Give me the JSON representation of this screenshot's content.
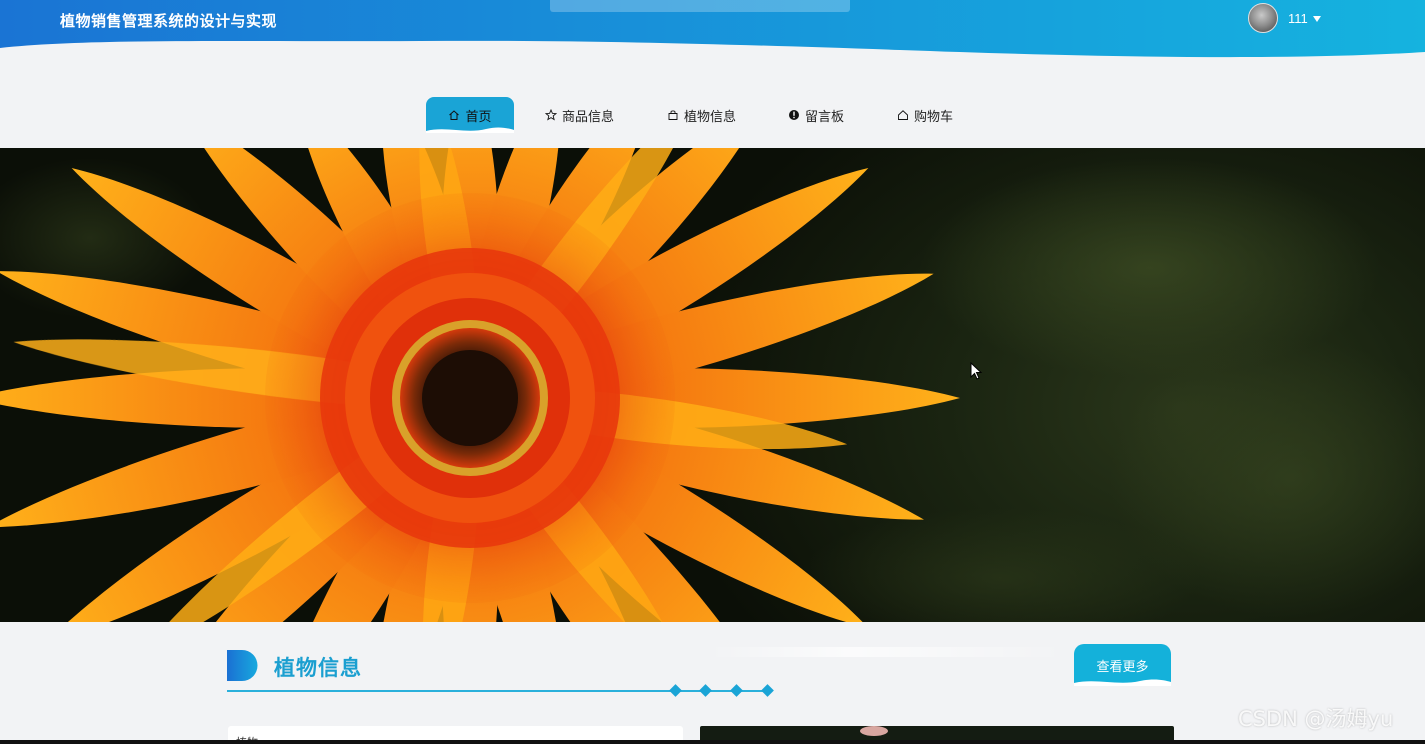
{
  "header": {
    "site_title": "植物销售管理系统的设计与实现",
    "user_name": "111",
    "gradient_start": "#1a78d6",
    "gradient_end": "#17b4e0"
  },
  "nav": {
    "items": [
      {
        "label": "首页",
        "icon": "home-icon",
        "active": true
      },
      {
        "label": "商品信息",
        "icon": "star-icon",
        "active": false
      },
      {
        "label": "植物信息",
        "icon": "bag-icon",
        "active": false
      },
      {
        "label": "留言板",
        "icon": "exclamation-circle-icon",
        "active": false
      },
      {
        "label": "购物车",
        "icon": "home-outline-icon",
        "active": false
      }
    ],
    "active_color": "#1aa4d6"
  },
  "hero": {
    "subject": "orange-gerbera-flower-banner"
  },
  "section": {
    "title": "植物信息",
    "more_label": "查看更多",
    "first_card_label": "植物"
  },
  "watermark": "CSDN @汤姆yu"
}
